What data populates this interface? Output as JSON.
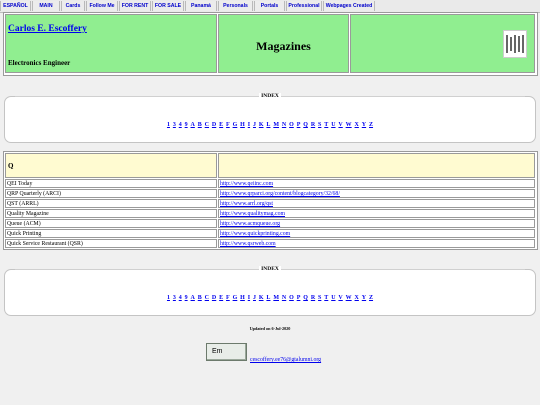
{
  "nav": [
    "ESPAÑOL",
    "MAIN",
    "Cards",
    "Follow Me",
    "FOR RENT",
    "FOR SALE",
    "Panamá",
    "Personals",
    "Portals",
    "Professional",
    "Webpages Created"
  ],
  "header": {
    "name": "Carlos E. Escoffery",
    "role": "Electronics Engineer",
    "title": "Magazines"
  },
  "index": {
    "label": "INDEX",
    "links": [
      "1",
      "3",
      "4",
      "9",
      "A",
      "B",
      "C",
      "D",
      "E",
      "F",
      "G",
      "H",
      "I",
      "J",
      "K",
      "L",
      "M",
      "N",
      "O",
      "P",
      "Q",
      "R",
      "S",
      "T",
      "U",
      "V",
      "W",
      "X",
      "Y",
      "Z"
    ]
  },
  "section": {
    "letter": "Q",
    "rows": [
      {
        "name": "QEI Today",
        "url": "http://www.qeiinc.com"
      },
      {
        "name": "QRP Quarterly (ARCI)",
        "url": "http://www.qrparci.org/content/blogcategory/32/68/"
      },
      {
        "name": "QST (ARRL)",
        "url": "http://www.arrl.org/qst"
      },
      {
        "name": "Quality Magazine",
        "url": "http://www.qualitymag.com"
      },
      {
        "name": "Queue (ACM)",
        "url": "http://www.acmqueue.org"
      },
      {
        "name": "Quick Printing",
        "url": "http://www.quickprinting.com"
      },
      {
        "name": "Quick Service Restaurant (QSR)",
        "url": "http://www.qsrweb.com"
      }
    ]
  },
  "footer": {
    "updated": "Updated on 6-Jul-2020",
    "button_label": "Em",
    "email": "cescoffery.ee76@gtalumni.org"
  }
}
